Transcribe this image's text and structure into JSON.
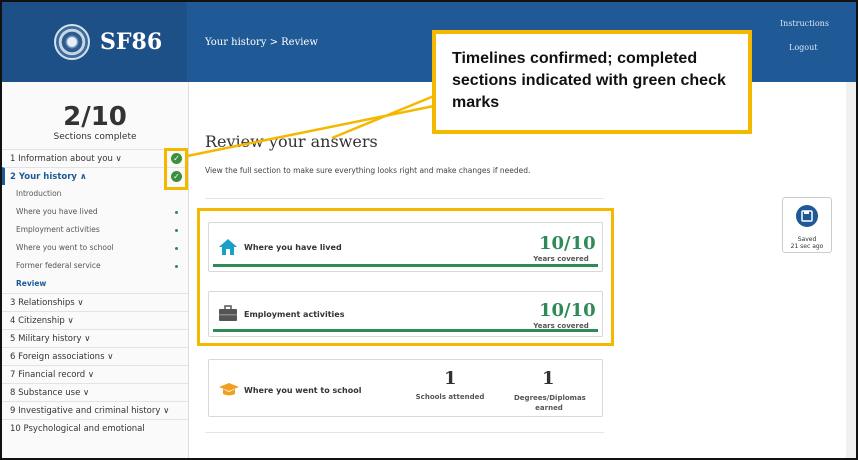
{
  "app": {
    "title": "SF86"
  },
  "header": {
    "breadcrumb": "Your history > Review",
    "instructions": "Instructions",
    "logout": "Logout"
  },
  "progress": {
    "count": "2/10",
    "label": "Sections complete"
  },
  "nav": {
    "s1": "1 Information about you ∨",
    "s2": "2 Your history ∧",
    "sub": [
      "Introduction",
      "Where you have lived",
      "Employment activities",
      "Where you went to school",
      "Former federal service",
      "Review"
    ],
    "s3": "3 Relationships ∨",
    "s4": "4 Citizenship ∨",
    "s5": "5 Military history ∨",
    "s6": "6 Foreign associations ∨",
    "s7": "7 Financial record ∨",
    "s8": "8 Substance use ∨",
    "s9": "9 Investigative and criminal history ∨",
    "s10": "10 Psychological and emotional"
  },
  "main": {
    "title": "Review your answers",
    "description": "View the full section to make sure everything looks right and make changes if needed.",
    "cards": {
      "lived": {
        "label": "Where you have lived",
        "value": "10/10",
        "sub": "Years covered",
        "fraction": 1.0
      },
      "employment": {
        "label": "Employment activities",
        "value": "10/10",
        "sub": "Years covered",
        "fraction": 1.0
      },
      "school": {
        "label": "Where you went to school",
        "schools_value": "1",
        "schools_label": "Schools attended",
        "degrees_value": "1",
        "degrees_label": "Degrees/Diplomas earned"
      }
    }
  },
  "saved": {
    "label": "Saved",
    "time": "21 sec ago"
  },
  "annotation": {
    "text": "Timelines confirmed; completed sections indicated with green check marks"
  },
  "colors": {
    "header": "#1f5a96",
    "accent_green": "#2e8b57",
    "highlight": "#f5b800"
  },
  "icons": [
    "house-icon",
    "briefcase-icon",
    "graduation-cap-icon",
    "floppy-disk-icon",
    "check-icon"
  ]
}
